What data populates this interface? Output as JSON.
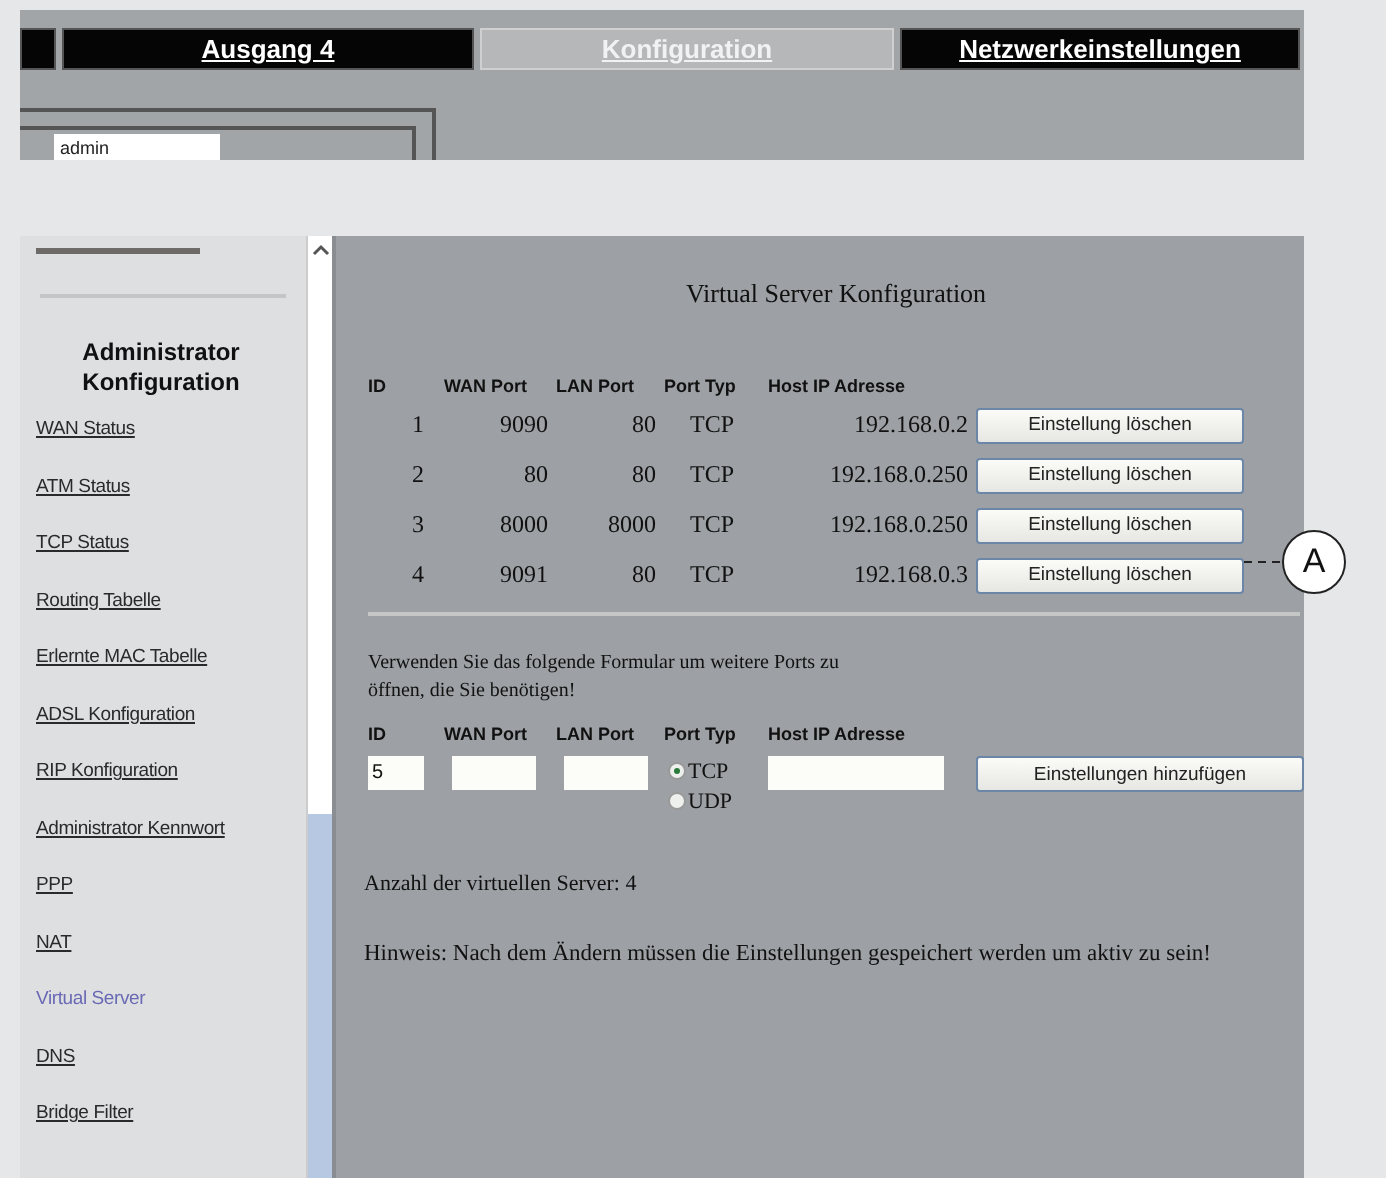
{
  "top_tabs": [
    {
      "selected": false
    },
    {
      "label": "Ausgang 4",
      "selected": false
    },
    {
      "label": "Konfiguration",
      "selected": true
    },
    {
      "label": "Netzwerkeinstellungen",
      "selected": false
    }
  ],
  "login_field": {
    "value": "admin"
  },
  "sidebar": {
    "title": "Administrator Konfiguration",
    "items": [
      {
        "label": "WAN Status",
        "selected": false
      },
      {
        "label": "ATM Status",
        "selected": false
      },
      {
        "label": "TCP Status",
        "selected": false
      },
      {
        "label": "Routing Tabelle",
        "selected": false
      },
      {
        "label": "Erlernte MAC Tabelle",
        "selected": false
      },
      {
        "label": "ADSL Konfiguration",
        "selected": false
      },
      {
        "label": "RIP Konfiguration",
        "selected": false
      },
      {
        "label": "Administrator Kennwort",
        "selected": false
      },
      {
        "label": "PPP",
        "selected": false
      },
      {
        "label": "NAT",
        "selected": false
      },
      {
        "label": "Virtual Server",
        "selected": true
      },
      {
        "label": "DNS",
        "selected": false
      },
      {
        "label": "Bridge Filter",
        "selected": false
      }
    ]
  },
  "content": {
    "title": "Virtual Server Konfiguration",
    "table": {
      "columns": [
        "ID",
        "WAN Port",
        "LAN Port",
        "Port Typ",
        "Host IP Adresse"
      ],
      "rows": [
        {
          "id": "1",
          "wan_port": "9090",
          "lan_port": "80",
          "port_type": "TCP",
          "host_ip": "192.168.0.2",
          "button": "Einstellung löschen"
        },
        {
          "id": "2",
          "wan_port": "80",
          "lan_port": "80",
          "port_type": "TCP",
          "host_ip": "192.168.0.250",
          "button": "Einstellung löschen"
        },
        {
          "id": "3",
          "wan_port": "8000",
          "lan_port": "8000",
          "port_type": "TCP",
          "host_ip": "192.168.0.250",
          "button": "Einstellung löschen"
        },
        {
          "id": "4",
          "wan_port": "9091",
          "lan_port": "80",
          "port_type": "TCP",
          "host_ip": "192.168.0.3",
          "button": "Einstellung löschen"
        }
      ]
    },
    "form_intro": "Verwenden Sie das folgende Formular um weitere Ports zu öffnen, die Sie benötigen!",
    "form": {
      "columns": [
        "ID",
        "WAN Port",
        "LAN Port",
        "Port Typ",
        "Host IP Adresse"
      ],
      "id_value": "5",
      "port_types": [
        {
          "label": "TCP",
          "selected": true
        },
        {
          "label": "UDP",
          "selected": false
        }
      ],
      "button": "Einstellungen hinzufügen"
    },
    "count": "Anzahl der virtuellen Server: 4",
    "note": "Hinweis: Nach dem Ändern müssen die Einstellungen gespeichert werden um aktiv zu sein!"
  },
  "callout": {
    "label": "A"
  }
}
